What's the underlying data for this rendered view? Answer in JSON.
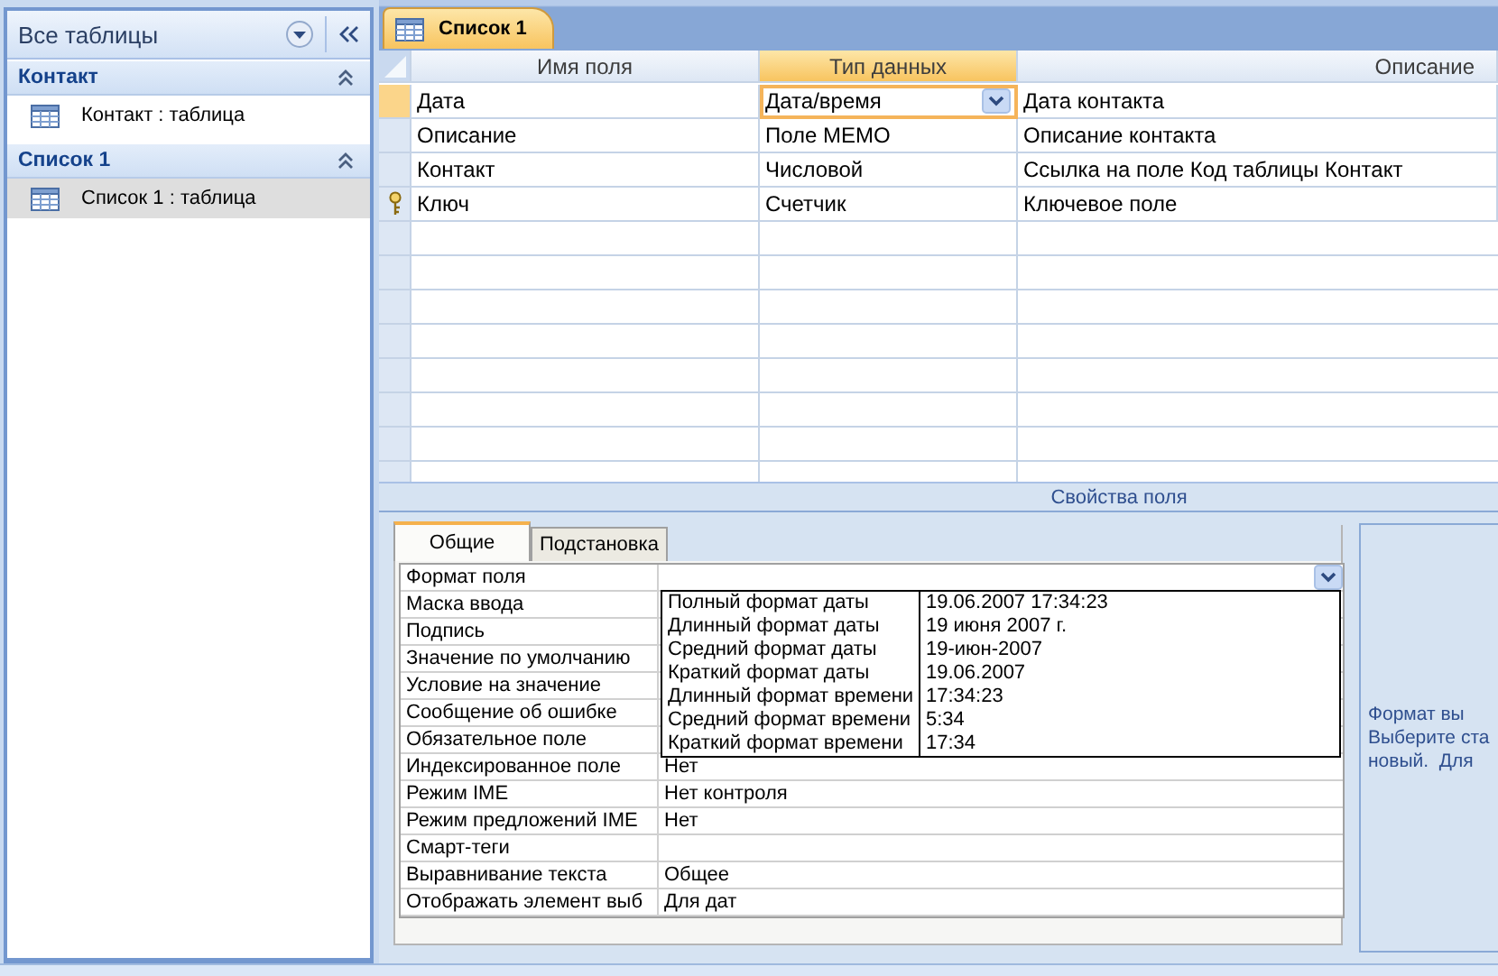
{
  "nav": {
    "title": "Все таблицы",
    "groups": [
      {
        "title": "Контакт",
        "expanded": true,
        "items": [
          {
            "label": "Контакт : таблица",
            "selected": false
          }
        ]
      },
      {
        "title": "Список 1",
        "expanded": true,
        "items": [
          {
            "label": "Список 1 : таблица",
            "selected": true
          }
        ]
      }
    ]
  },
  "document_tabs": [
    {
      "label": "Список 1",
      "selected": true
    }
  ],
  "design_grid": {
    "columns": [
      {
        "label": "Имя поля",
        "selected": false
      },
      {
        "label": "Тип данных",
        "selected": true
      },
      {
        "label": "Описание",
        "selected": false
      }
    ],
    "rows": [
      {
        "name": "Дата",
        "type": "Дата/время",
        "description": "Дата контакта",
        "selected": true,
        "primary_key": false
      },
      {
        "name": "Описание",
        "type": "Поле MEMO",
        "description": "Описание контакта",
        "selected": false,
        "primary_key": false
      },
      {
        "name": "Контакт",
        "type": "Числовой",
        "description": "Ссылка на поле Код таблицы Контакт",
        "selected": false,
        "primary_key": false
      },
      {
        "name": "Ключ",
        "type": "Счетчик",
        "description": "Ключевое поле",
        "selected": false,
        "primary_key": true
      }
    ]
  },
  "field_properties": {
    "title": "Свойства поля",
    "tabs": [
      {
        "label": "Общие",
        "selected": true
      },
      {
        "label": "Подстановка",
        "selected": false
      }
    ],
    "rows": [
      {
        "label": "Формат поля",
        "kind": "combo"
      },
      {
        "label": "Маска ввода",
        "kind": "text"
      },
      {
        "label": "Подпись",
        "kind": "text"
      },
      {
        "label": "Значение по умолчанию",
        "kind": "text"
      },
      {
        "label": "Условие на значение",
        "kind": "text"
      },
      {
        "label": "Сообщение об ошибке",
        "kind": "text"
      },
      {
        "label": "Обязательное поле",
        "kind": "text"
      },
      {
        "label": "Индексированное поле",
        "kind": "text",
        "value": "Нет"
      },
      {
        "label": "Режим IME",
        "kind": "text",
        "value": "Нет контроля"
      },
      {
        "label": "Режим предложений IME",
        "kind": "text",
        "value": "Нет"
      },
      {
        "label": "Смарт-теги",
        "kind": "text"
      },
      {
        "label": "Выравнивание текста",
        "kind": "text",
        "value": "Общее"
      },
      {
        "label": "Отображать элемент выб",
        "kind": "text",
        "value": "Для дат"
      }
    ],
    "format_list": {
      "open": true,
      "options": [
        {
          "name": "Полный формат даты",
          "example": "19.06.2007 17:34:23"
        },
        {
          "name": "Длинный формат даты",
          "example": "19 июня 2007 г."
        },
        {
          "name": "Средний формат даты",
          "example": "19-июн-2007"
        },
        {
          "name": "Краткий формат даты",
          "example": "19.06.2007"
        },
        {
          "name": "Длинный формат времени",
          "example": "17:34:23"
        },
        {
          "name": "Средний формат времени",
          "example": "5:34"
        },
        {
          "name": "Краткий формат времени",
          "example": "17:34"
        }
      ]
    },
    "help_lines": [
      "Формат вы",
      "Выберите ста",
      "новый.  Для"
    ]
  }
}
